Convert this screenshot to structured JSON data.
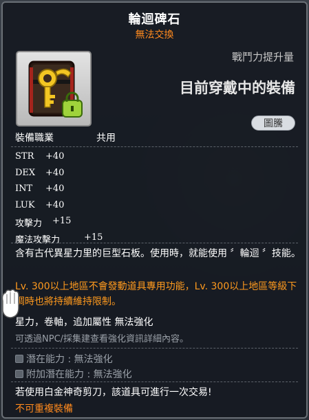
{
  "item": {
    "name": "輪迴碑石",
    "trade_status": "無法交換",
    "icon": "grave-stone-lock-icon"
  },
  "header": {
    "power_label": "戰鬥力提升量",
    "equipped_label": "目前穿戴中的裝備",
    "tag_label": "圖騰"
  },
  "job": {
    "label": "裝備職業",
    "value": "共用"
  },
  "stats": [
    {
      "name": "STR",
      "value": "+40"
    },
    {
      "name": "DEX",
      "value": "+40"
    },
    {
      "name": "INT",
      "value": "+40"
    },
    {
      "name": "LUK",
      "value": "+40"
    },
    {
      "name": "攻擊力",
      "value": "+15"
    },
    {
      "name": "魔法攻擊力",
      "value": "+15"
    }
  ],
  "description": "含有古代異星力里的巨型石板。使用時，就能使用 〞輪迴 〞技能。",
  "warning": "Lv. 300以上地區不會發動道具專用功能，Lv. 300以上地區等級下調時也將持續維持限制。",
  "enhancement": {
    "text": "星力，卷軸，追加屬性 無法強化",
    "hint": "可透過NPC/採集建查看強化資訊詳細內容。"
  },
  "potential": {
    "potential_label": "潛在能力 : 無法強化",
    "additional_label": "附加潛在能力 : 無法強化"
  },
  "footer": {
    "scissors_text": "若使用白金神奇剪刀，該道具可進行一次交易!",
    "unique_text": "不可重複裝備"
  },
  "colors": {
    "accent_orange": "#ff8a1e",
    "tooltip_bg": "#161a21",
    "muted_text": "#9aa0a8"
  }
}
